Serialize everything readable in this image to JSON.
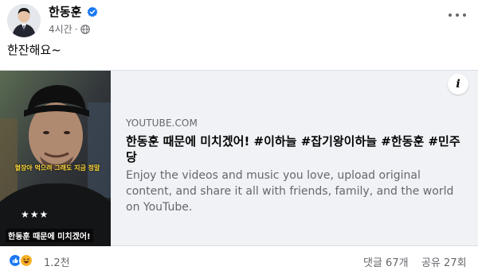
{
  "post": {
    "author": "한동훈",
    "time": "4시간",
    "separator": "·",
    "text": "한잔해요~"
  },
  "link_card": {
    "domain": "YOUTUBE.COM",
    "title": "한동훈 때문에 미치겠어! #이하늘 #잡기왕이하늘 #한동훈 #민주당",
    "description": "Enjoy the videos and music you love, upload original content, and share it all with friends, family, and the world on YouTube.",
    "info_glyph": "i",
    "thumbnail": {
      "caption_top": "혈장아 먹으려 그래도 지금 정말",
      "stars": "★★★",
      "caption_bottom": "한동훈 때문에 미치겠어!"
    }
  },
  "footer": {
    "reaction_count": "1.2천",
    "comments": "댓글 67개",
    "shares": "공유 27회"
  },
  "icons": {
    "verified": "verified-badge-icon",
    "audience": "globe-icon",
    "more": "more-options-icon",
    "like": "like-reaction-icon",
    "haha": "haha-reaction-icon"
  },
  "colors": {
    "verified": "#1877f2",
    "like": "#1877f2",
    "haha": "#f7b125",
    "card_bg": "#f0f2f5",
    "secondary_text": "#65676b"
  }
}
